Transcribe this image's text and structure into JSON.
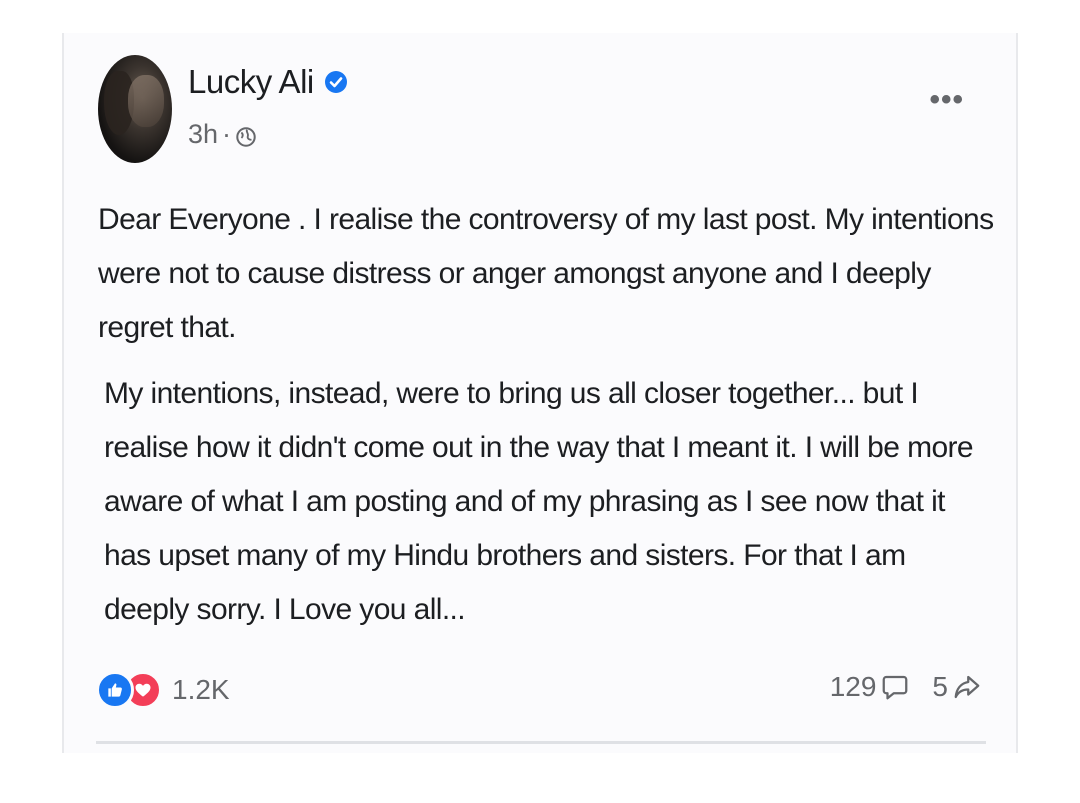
{
  "post": {
    "author": "Lucky Ali",
    "time": "3h",
    "separator": "·",
    "more_label": "•••",
    "paragraphs": [
      "Dear Everyone . I realise the controversy of my last post. My intentions were not to cause distress or anger amongst anyone and I deeply regret that.",
      "My intentions, instead, were to bring us all closer together... but I realise how it didn't come out in the way that I meant it. I will be more aware of what I am posting and of my phrasing as I see now that it has upset many of my Hindu brothers  and sisters. For that I am deeply sorry. I Love you all..."
    ]
  },
  "engagement": {
    "reactions": "1.2K",
    "comments": "129",
    "shares": "5"
  },
  "icons": {
    "verified": "verified-badge-icon",
    "audience": "globe-icon",
    "like": "like-icon",
    "love": "love-icon",
    "comment": "comment-icon",
    "share": "share-icon"
  },
  "colors": {
    "verified": "#1877f2",
    "like": "#1877f2",
    "love": "#f33e58",
    "text": "#1c1e21",
    "muted": "#65676b"
  }
}
